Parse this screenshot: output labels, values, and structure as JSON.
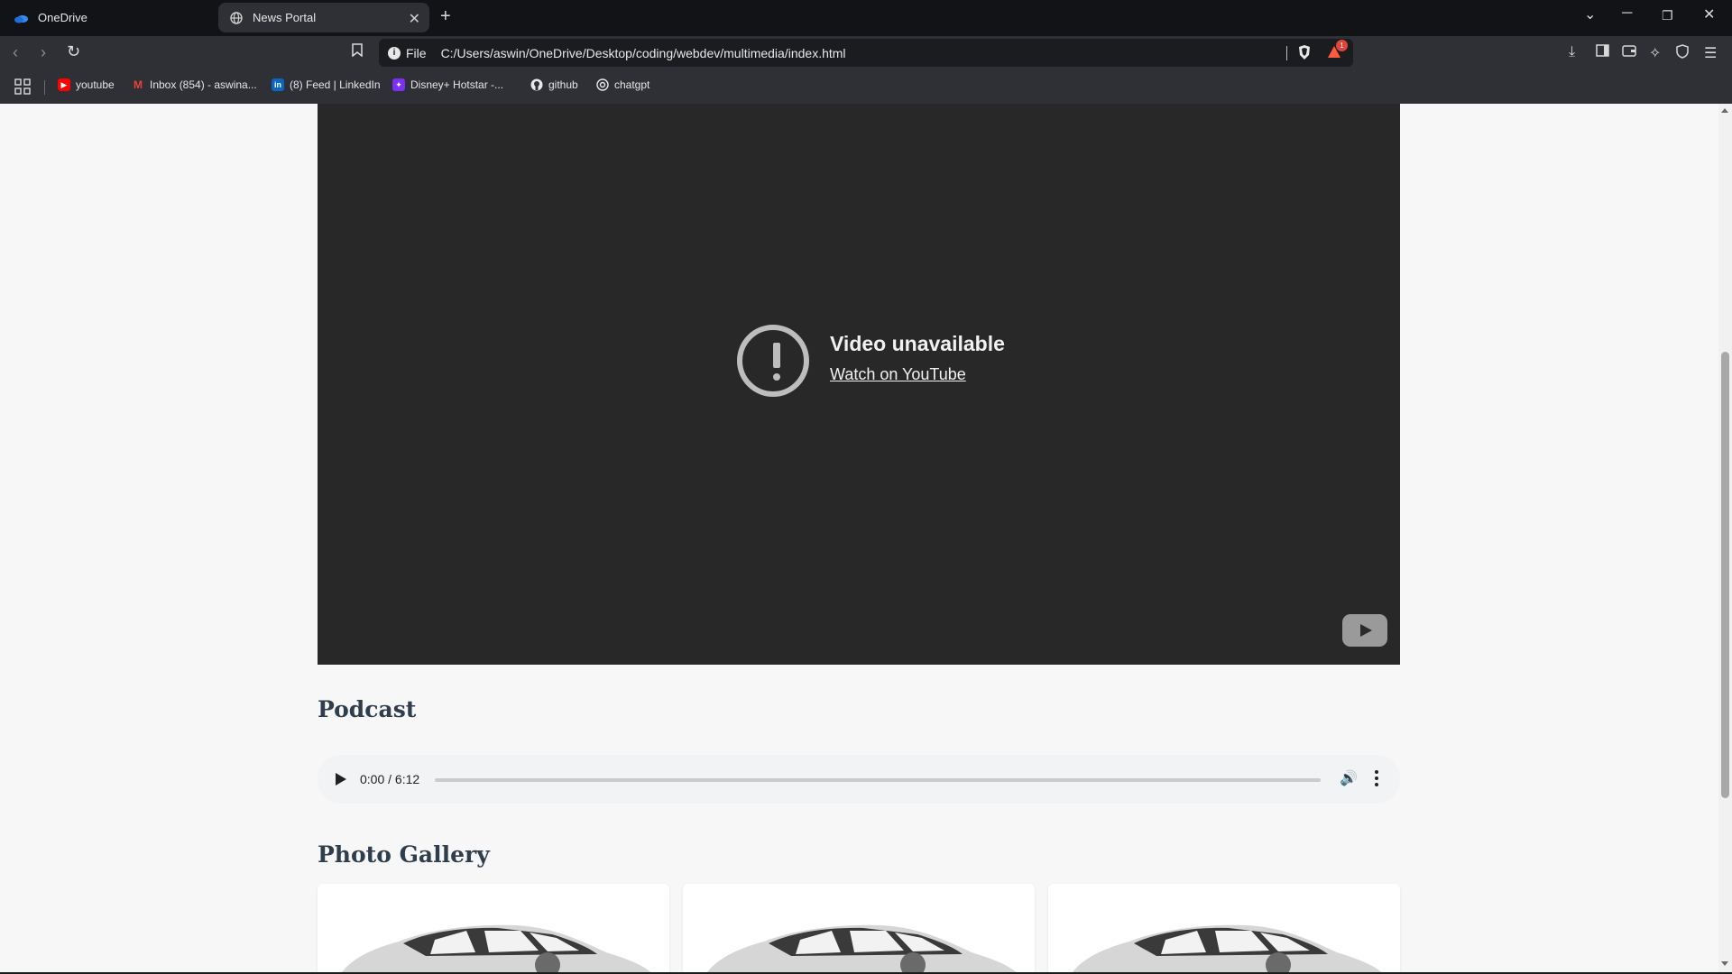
{
  "browser": {
    "tabs": [
      {
        "title": "OneDrive",
        "active": false
      },
      {
        "title": "News Portal",
        "active": true
      }
    ],
    "url_scheme_label": "File",
    "url": "C:/Users/aswin/OneDrive/Desktop/coding/webdev/multimedia/index.html",
    "shields_badge": "1",
    "bookmarks": [
      {
        "label": "youtube",
        "icon": "youtube-icon",
        "color": "#ff0000"
      },
      {
        "label": "Inbox (854) - aswina...",
        "icon": "gmail-icon",
        "color": "#ea4335"
      },
      {
        "label": "(8) Feed | LinkedIn",
        "icon": "linkedin-icon",
        "color": "#0a66c2"
      },
      {
        "label": "Disney+ Hotstar -...",
        "icon": "hotstar-icon",
        "color": "#7b2ff7"
      },
      {
        "label": "github",
        "icon": "github-icon",
        "color": "#ffffff"
      },
      {
        "label": "chatgpt",
        "icon": "chatgpt-icon",
        "color": "#ffffff"
      }
    ]
  },
  "page": {
    "video": {
      "error_title": "Video unavailable",
      "error_link": "Watch on YouTube"
    },
    "podcast": {
      "heading": "Podcast",
      "time": "0:00 / 6:12",
      "progress": 0
    },
    "gallery": {
      "heading": "Photo Gallery",
      "image_count": 3
    }
  }
}
